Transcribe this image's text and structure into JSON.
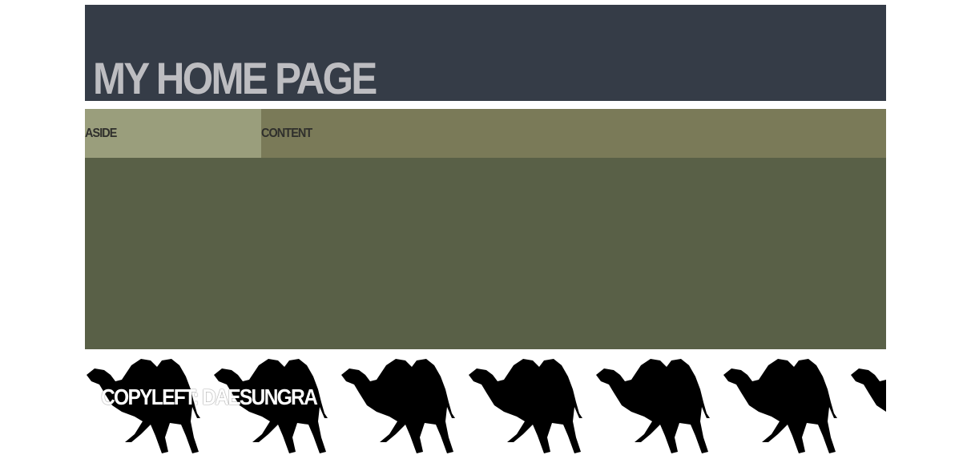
{
  "header": {
    "title": "MY HOME PAGE"
  },
  "main": {
    "aside_label": "ASIDE",
    "content_label": "CONTENT"
  },
  "footer": {
    "copyright": "COPYLEFT: DAESUNGRA",
    "background_icon": "camel-icon"
  },
  "colors": {
    "header_bg": "#353c47",
    "title_text": "#bdbdc1",
    "aside_bg": "#9a9e7c",
    "content_bg": "#7a7a58",
    "main_bg": "#596047",
    "footer_text": "#ffffff"
  }
}
